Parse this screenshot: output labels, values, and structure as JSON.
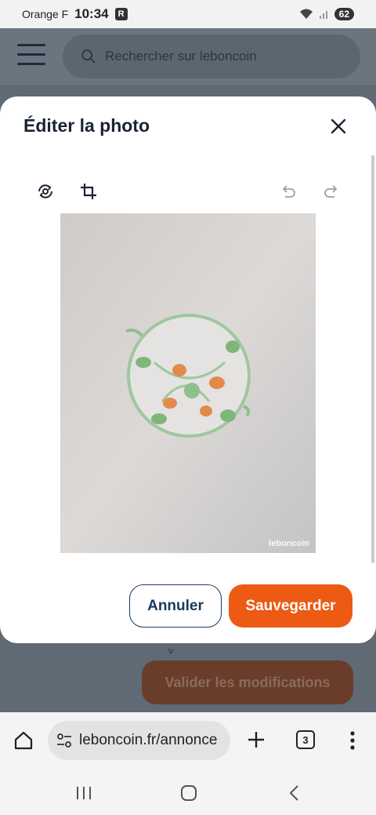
{
  "status_bar": {
    "carrier": "Orange F",
    "time": "10:34",
    "notification_badge": "R",
    "battery": "62"
  },
  "header": {
    "search_placeholder": "Rechercher sur leboncoin"
  },
  "background_page": {
    "validate_label": "Valider les modifications"
  },
  "modal": {
    "title": "Éditer la photo",
    "photo_watermark": "leboncoin",
    "cancel_label": "Annuler",
    "save_label": "Sauvegarder"
  },
  "browser": {
    "url": "leboncoin.fr/annonce",
    "tab_count": "3"
  },
  "colors": {
    "accent": "#ec5a13",
    "primary_dark": "#1a3a5c"
  }
}
